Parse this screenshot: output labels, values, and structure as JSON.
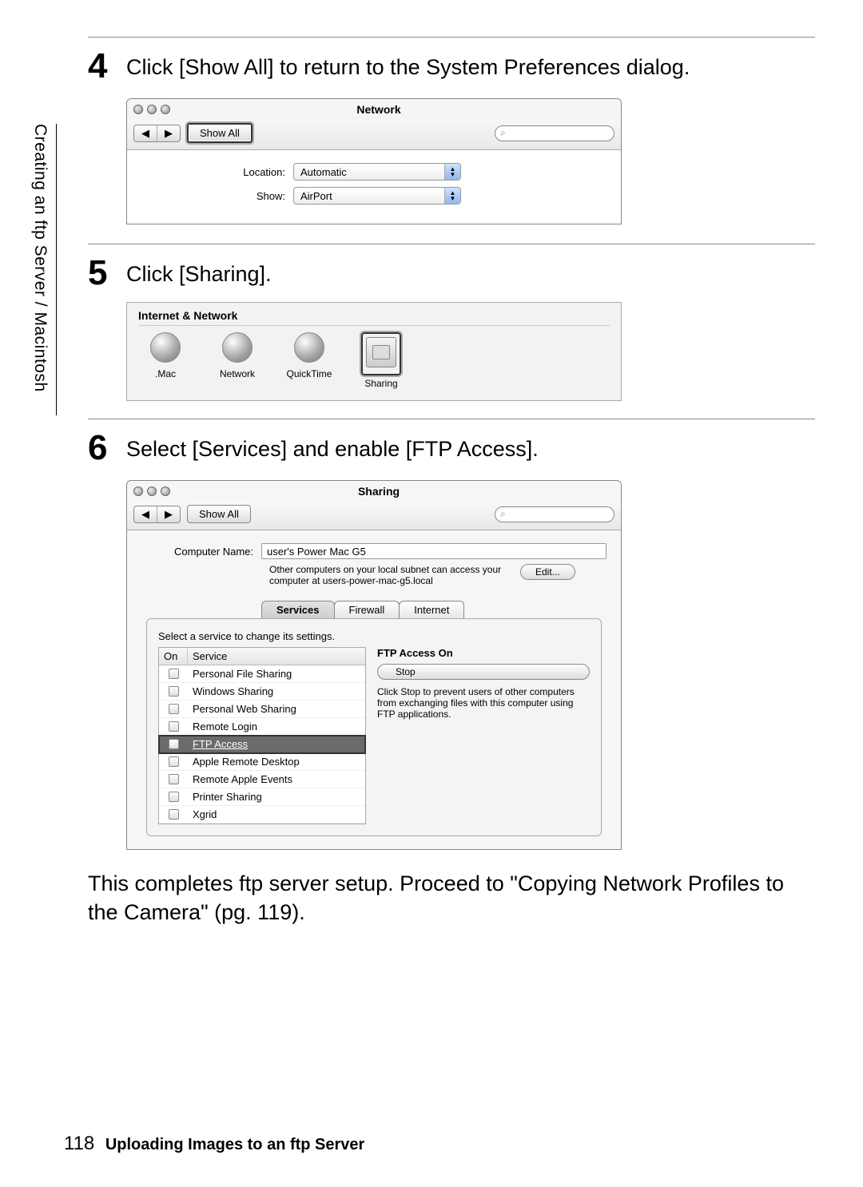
{
  "side_tab": "Creating an ftp Server / Macintosh",
  "steps": {
    "s4": {
      "num": "4",
      "text": "Click [Show All] to return to the System Preferences dialog.",
      "window": {
        "title": "Network",
        "show_all": "Show All",
        "search_icon": "⌕",
        "rows": {
          "location_label": "Location:",
          "location_value": "Automatic",
          "show_label": "Show:",
          "show_value": "AirPort"
        }
      }
    },
    "s5": {
      "num": "5",
      "text": "Click [Sharing].",
      "section_title": "Internet & Network",
      "items": [
        {
          "label": ".Mac"
        },
        {
          "label": "Network"
        },
        {
          "label": "QuickTime"
        },
        {
          "label": "Sharing"
        }
      ]
    },
    "s6": {
      "num": "6",
      "text": "Select [Services] and enable [FTP Access].",
      "window": {
        "title": "Sharing",
        "show_all": "Show All",
        "search_icon": "⌕",
        "computer_name_label": "Computer Name:",
        "computer_name_value": "user's Power Mac G5",
        "subnet_note": "Other computers on your local subnet can access your computer at users-power-mac-g5.local",
        "edit": "Edit...",
        "tabs": {
          "services": "Services",
          "firewall": "Firewall",
          "internet": "Internet"
        },
        "hint": "Select a service to change its settings.",
        "hdr_on": "On",
        "hdr_service": "Service",
        "services": [
          {
            "on": false,
            "name": "Personal File Sharing"
          },
          {
            "on": false,
            "name": "Windows Sharing"
          },
          {
            "on": false,
            "name": "Personal Web Sharing"
          },
          {
            "on": false,
            "name": "Remote Login",
            "truncated": true
          },
          {
            "on": true,
            "name": "FTP Access"
          },
          {
            "on": false,
            "name": "Apple Remote Desktop",
            "truncated": true
          },
          {
            "on": false,
            "name": "Remote Apple Events"
          },
          {
            "on": false,
            "name": "Printer Sharing"
          },
          {
            "on": false,
            "name": "Xgrid"
          }
        ],
        "info": {
          "heading": "FTP Access On",
          "stop": "Stop",
          "note": "Click Stop to prevent users of other computers from exchanging files with this computer using FTP applications."
        }
      }
    },
    "completion": "This completes ftp server setup.  Proceed to \"Copying Network Profiles to the Camera\" (pg. 119)."
  },
  "footer": {
    "page": "118",
    "title": "Uploading Images to an ftp Server"
  }
}
